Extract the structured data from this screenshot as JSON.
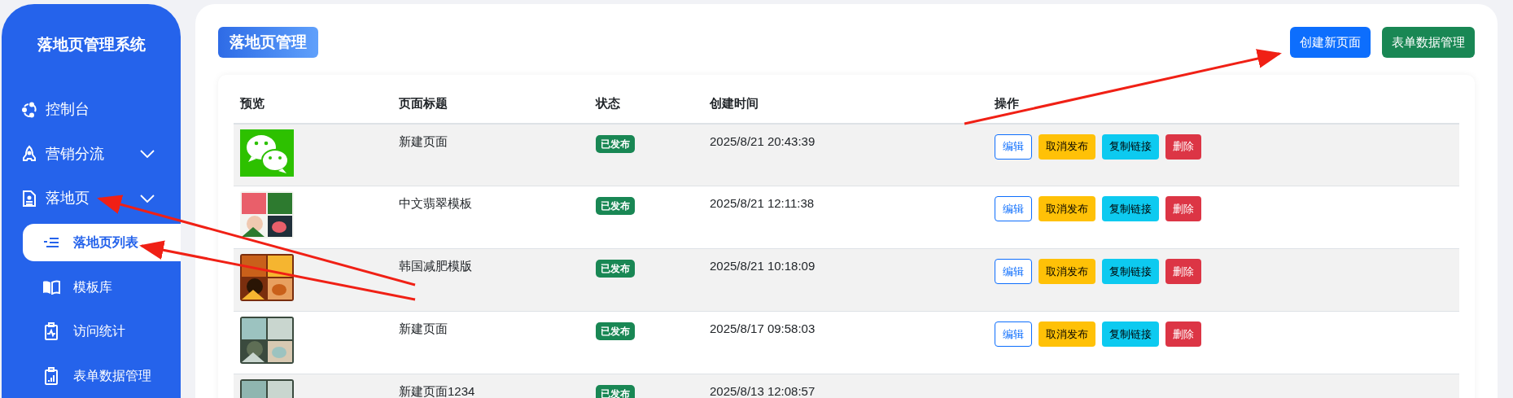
{
  "sidebar": {
    "title": "落地页管理系统",
    "items": [
      {
        "label": "控制台",
        "kind": "link"
      },
      {
        "label": "营销分流",
        "kind": "group"
      },
      {
        "label": "落地页",
        "kind": "group",
        "children": [
          {
            "label": "落地页列表",
            "selected": true
          },
          {
            "label": "模板库",
            "selected": false
          },
          {
            "label": "访问统计",
            "selected": false
          },
          {
            "label": "表单数据管理",
            "selected": false
          }
        ]
      }
    ]
  },
  "header": {
    "title": "落地页管理",
    "buttons": [
      {
        "label": "创建新页面",
        "kind": "primary"
      },
      {
        "label": "表单数据管理",
        "kind": "success"
      }
    ]
  },
  "table": {
    "columns": [
      "预览",
      "页面标题",
      "状态",
      "创建时间",
      "操作"
    ],
    "rows": [
      {
        "preview": {
          "kind": "logo"
        },
        "title": "新建页面",
        "status": "已发布",
        "created": "2025/8/21 20:43:39",
        "actions": [
          "编辑",
          "取消发布",
          "复制链接",
          "删除"
        ]
      },
      {
        "preview": {
          "kind": "picture"
        },
        "title": "中文翡翠模板",
        "status": "已发布",
        "created": "2025/8/21 12:11:38",
        "actions": [
          "编辑",
          "取消发布",
          "复制链接",
          "删除"
        ]
      },
      {
        "preview": {
          "kind": "picture"
        },
        "title": "韩国减肥模版",
        "status": "已发布",
        "created": "2025/8/21 10:18:09",
        "actions": [
          "编辑",
          "取消发布",
          "复制链接",
          "删除"
        ]
      },
      {
        "preview": {
          "kind": "picture"
        },
        "title": "新建页面",
        "status": "已发布",
        "created": "2025/8/17 09:58:03",
        "actions": [
          "编辑",
          "取消发布",
          "复制链接",
          "删除"
        ]
      },
      {
        "preview": {
          "kind": "picture"
        },
        "title": "新建页面1234",
        "status": "已发布",
        "created": "2025/8/13 12:08:57"
      }
    ]
  }
}
